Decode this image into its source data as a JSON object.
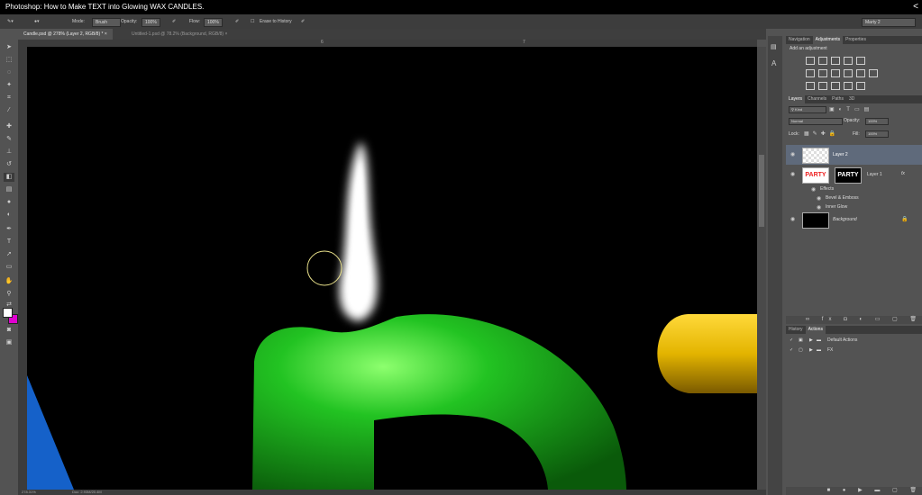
{
  "window": {
    "title": "Photoshop: How to Make TEXT into Glowing WAX CANDLES.",
    "share_icon": "share-icon"
  },
  "options": {
    "mode_label": "Mode:",
    "mode_value": "Brush",
    "opacity_label": "Opacity:",
    "opacity_value": "100%",
    "flow_label": "Flow:",
    "flow_value": "100%",
    "erase_history": "Erase to History",
    "workspace": "Marty 2"
  },
  "tabs": [
    {
      "label": "Candle.psd @ 278% (Layer 2, RGB/8) *",
      "close": "×"
    },
    {
      "label": "Untitled-1.psd @ 78.2% (Background, RGB/8)",
      "close": "×"
    }
  ],
  "rulers": {
    "h1": "6",
    "h2": "7"
  },
  "status": {
    "zoom": "278.31%",
    "doc": "Doc: 2.93M/20.4M"
  },
  "canvas_colors": {
    "flame": "#ffffff",
    "candle_green": "#22c322",
    "candle_yellow": "#e3b400",
    "candle_blue": "#1561c9",
    "background": "#000000"
  },
  "swatches": {
    "foreground": "#ffffff",
    "background": "#e000d0"
  },
  "panels": {
    "top_tabs": [
      "Navigation",
      "Adjustments",
      "Properties"
    ],
    "adjust_title": "Add an adjustment",
    "layer_tabs": [
      "Layers",
      "Channels",
      "Paths",
      "3D"
    ],
    "kind_label": "Kind",
    "blend_mode": "Normal",
    "opacity_label": "Opacity:",
    "opacity_value": "100%",
    "lock_label": "Lock:",
    "fill_label": "Fill:",
    "fill_value": "100%",
    "layers": {
      "layer2": "Layer 2",
      "layer1": "Layer 1",
      "party_text": "PARTY",
      "effects": "Effects",
      "bevel": "Bevel & Emboss",
      "inner_glow": "Inner Glow",
      "background": "Background",
      "fx": "fx"
    },
    "history_tabs": [
      "History",
      "Actions"
    ],
    "actions": [
      "Default Actions",
      "FX"
    ]
  }
}
